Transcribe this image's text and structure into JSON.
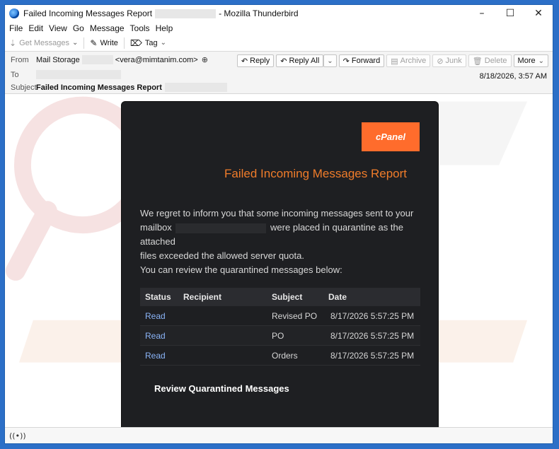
{
  "window": {
    "title_prefix": "Failed Incoming Messages Report",
    "title_suffix": "- Mozilla Thunderbird",
    "minimize": "–",
    "maximize": "☐",
    "close": "✕"
  },
  "menu": [
    "File",
    "Edit",
    "View",
    "Go",
    "Message",
    "Tools",
    "Help"
  ],
  "toolbar": {
    "get_messages": "Get Messages",
    "write": "Write",
    "tag": "Tag"
  },
  "header": {
    "from_label": "From",
    "from_name": "Mail Storage",
    "from_email": "<vera@mimtanim.com>",
    "to_label": "To",
    "subject_label": "Subject",
    "subject": "Failed Incoming Messages Report",
    "date": "8/18/2026, 3:57 AM",
    "actions": {
      "reply": "Reply",
      "reply_all": "Reply All",
      "forward": "Forward",
      "archive": "Archive",
      "junk": "Junk",
      "delete": "Delete",
      "more": "More"
    }
  },
  "email": {
    "logo_text": "cPanel",
    "title": "Failed Incoming Messages Report",
    "intro_line1": "We regret to inform you that some incoming messages sent to your",
    "intro_line2a": "mailbox",
    "intro_line2b": "were placed in quarantine as the attached",
    "intro_line3": "files exceeded the allowed server quota.",
    "intro_line4": "You can review the quarantined messages below:",
    "table": {
      "headers": [
        "Status",
        "Recipient",
        "Subject",
        "Date"
      ],
      "rows": [
        {
          "status": "Read",
          "recipient": "",
          "subject": "Revised PO",
          "date": "8/17/2026 5:57:25 PM"
        },
        {
          "status": "Read",
          "recipient": "",
          "subject": "PO",
          "date": "8/17/2026 5:57:25 PM"
        },
        {
          "status": "Read",
          "recipient": "",
          "subject": "Orders",
          "date": "8/17/2026 5:57:25 PM"
        }
      ]
    },
    "review_button": "Review Quarantined Messages"
  },
  "colors": {
    "accent": "#ff6c2c",
    "title_orange": "#f07c2a",
    "link": "#8ab4f8",
    "card_bg": "#1e1f22"
  }
}
